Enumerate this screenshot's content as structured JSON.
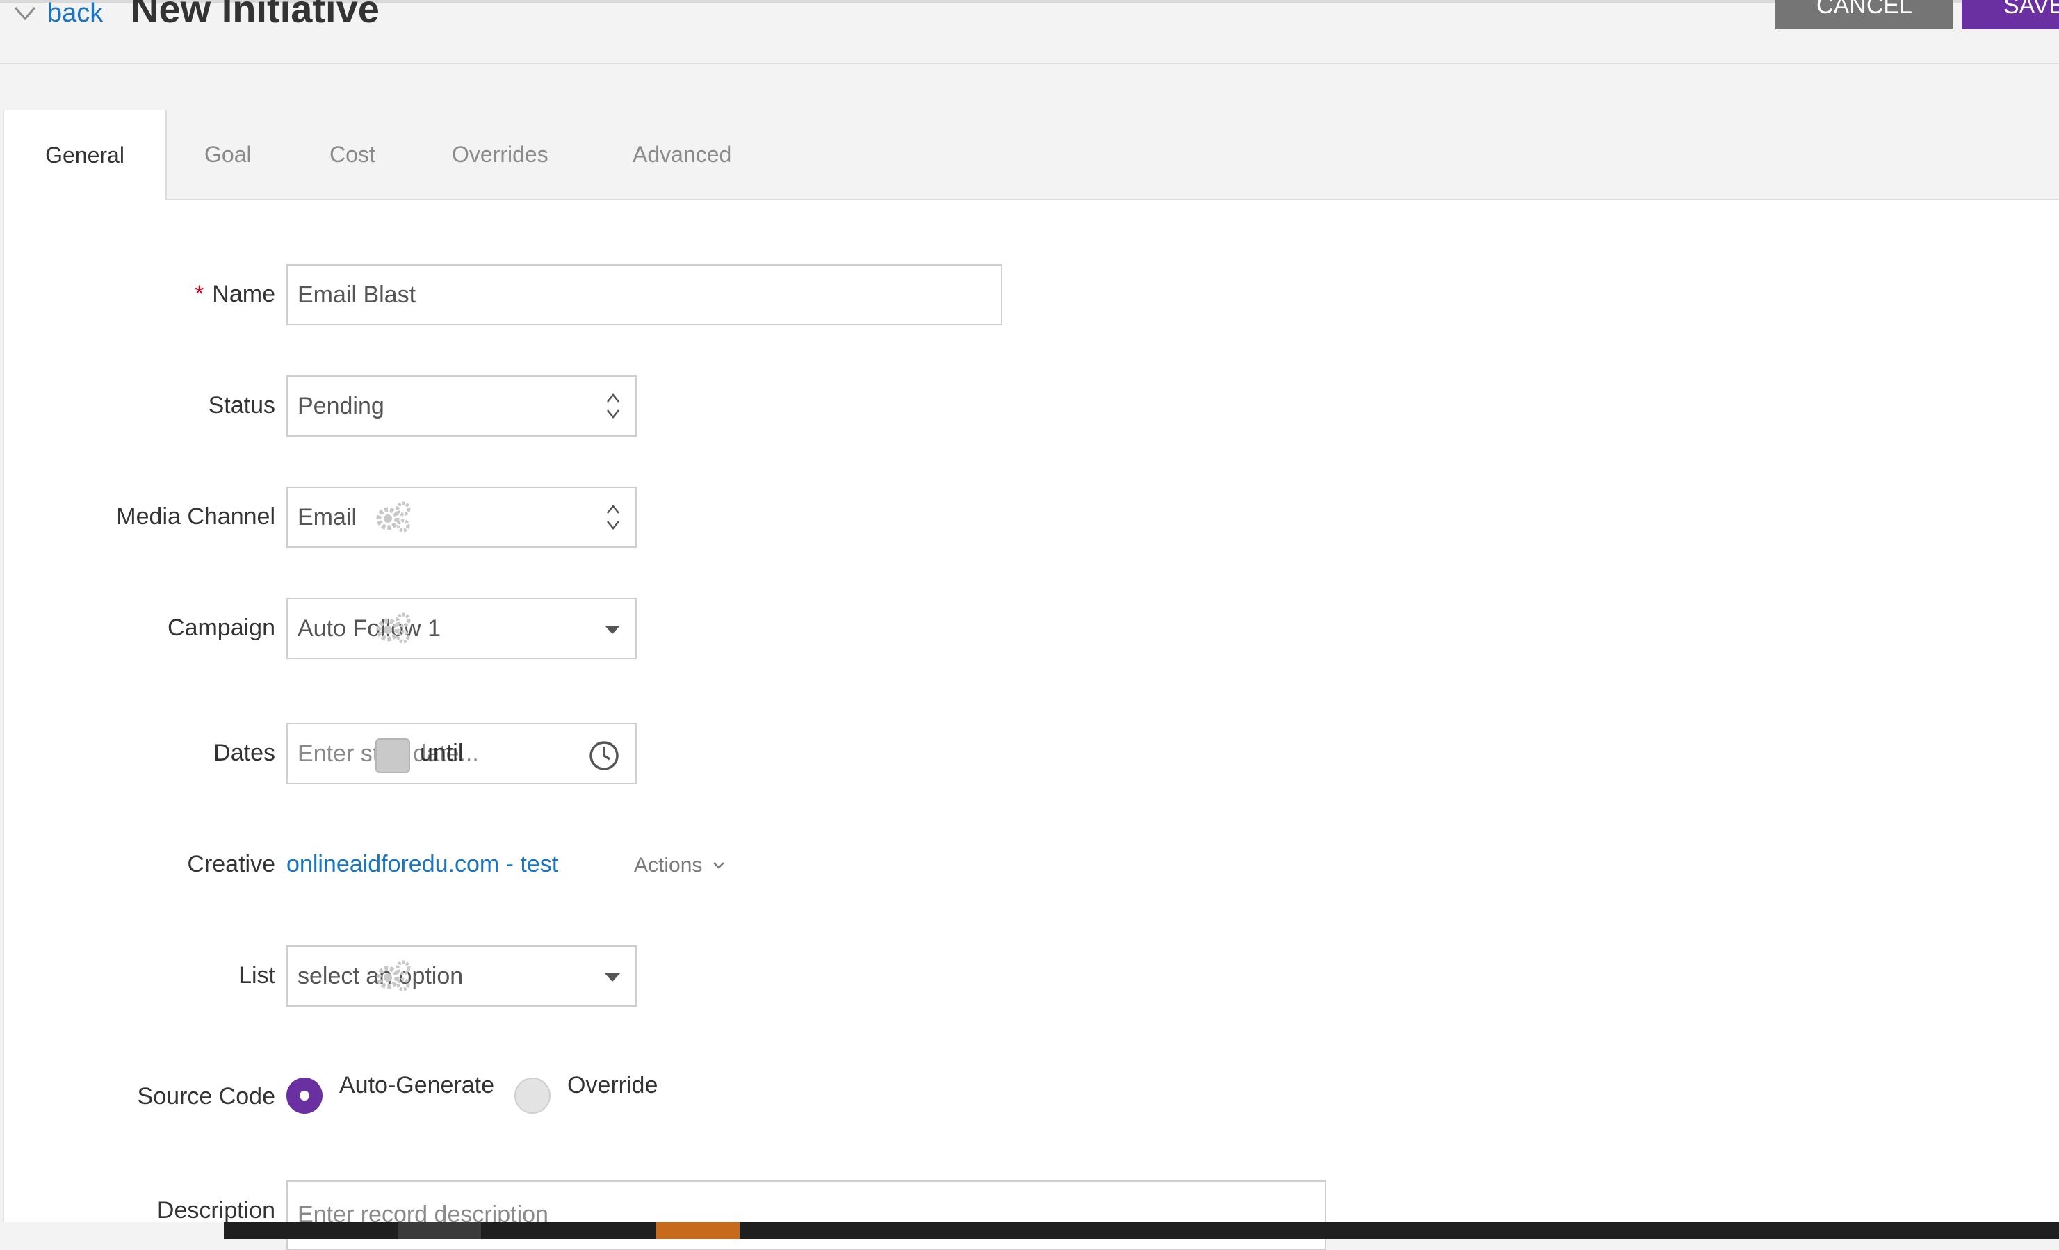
{
  "header": {
    "back_label": "back",
    "title": "New Initiative",
    "cancel_label": "CANCEL",
    "save_label": "SAVE"
  },
  "tabs": [
    {
      "label": "General",
      "active": true
    },
    {
      "label": "Goal",
      "active": false
    },
    {
      "label": "Cost",
      "active": false
    },
    {
      "label": "Overrides",
      "active": false
    },
    {
      "label": "Advanced",
      "active": false
    }
  ],
  "form": {
    "name": {
      "label": "Name",
      "required_mark": "*",
      "value": "Email Blast"
    },
    "status": {
      "label": "Status",
      "value": "Pending"
    },
    "media_channel": {
      "label": "Media Channel",
      "value": "Email"
    },
    "campaign": {
      "label": "Campaign",
      "value": "Auto Follow 1"
    },
    "dates": {
      "label": "Dates",
      "placeholder": "Enter start date...",
      "until_label": "until",
      "until_checked": false
    },
    "creative": {
      "label": "Creative",
      "link": "onlineaidforedu.com - test",
      "actions_label": "Actions"
    },
    "list": {
      "label": "List",
      "placeholder": "select an option"
    },
    "source_code": {
      "label": "Source Code",
      "options": [
        "Auto-Generate",
        "Override"
      ],
      "selected": "Auto-Generate"
    },
    "description": {
      "label": "Description",
      "placeholder": "Enter record description"
    }
  },
  "colors": {
    "accent": "#6a2fa0",
    "link": "#1a76c2",
    "cancel": "#757575",
    "required": "#d0021b"
  },
  "icons": [
    "chevron-down-icon",
    "spinner-icon",
    "gear-icon",
    "clock-icon",
    "caret-down-icon"
  ]
}
